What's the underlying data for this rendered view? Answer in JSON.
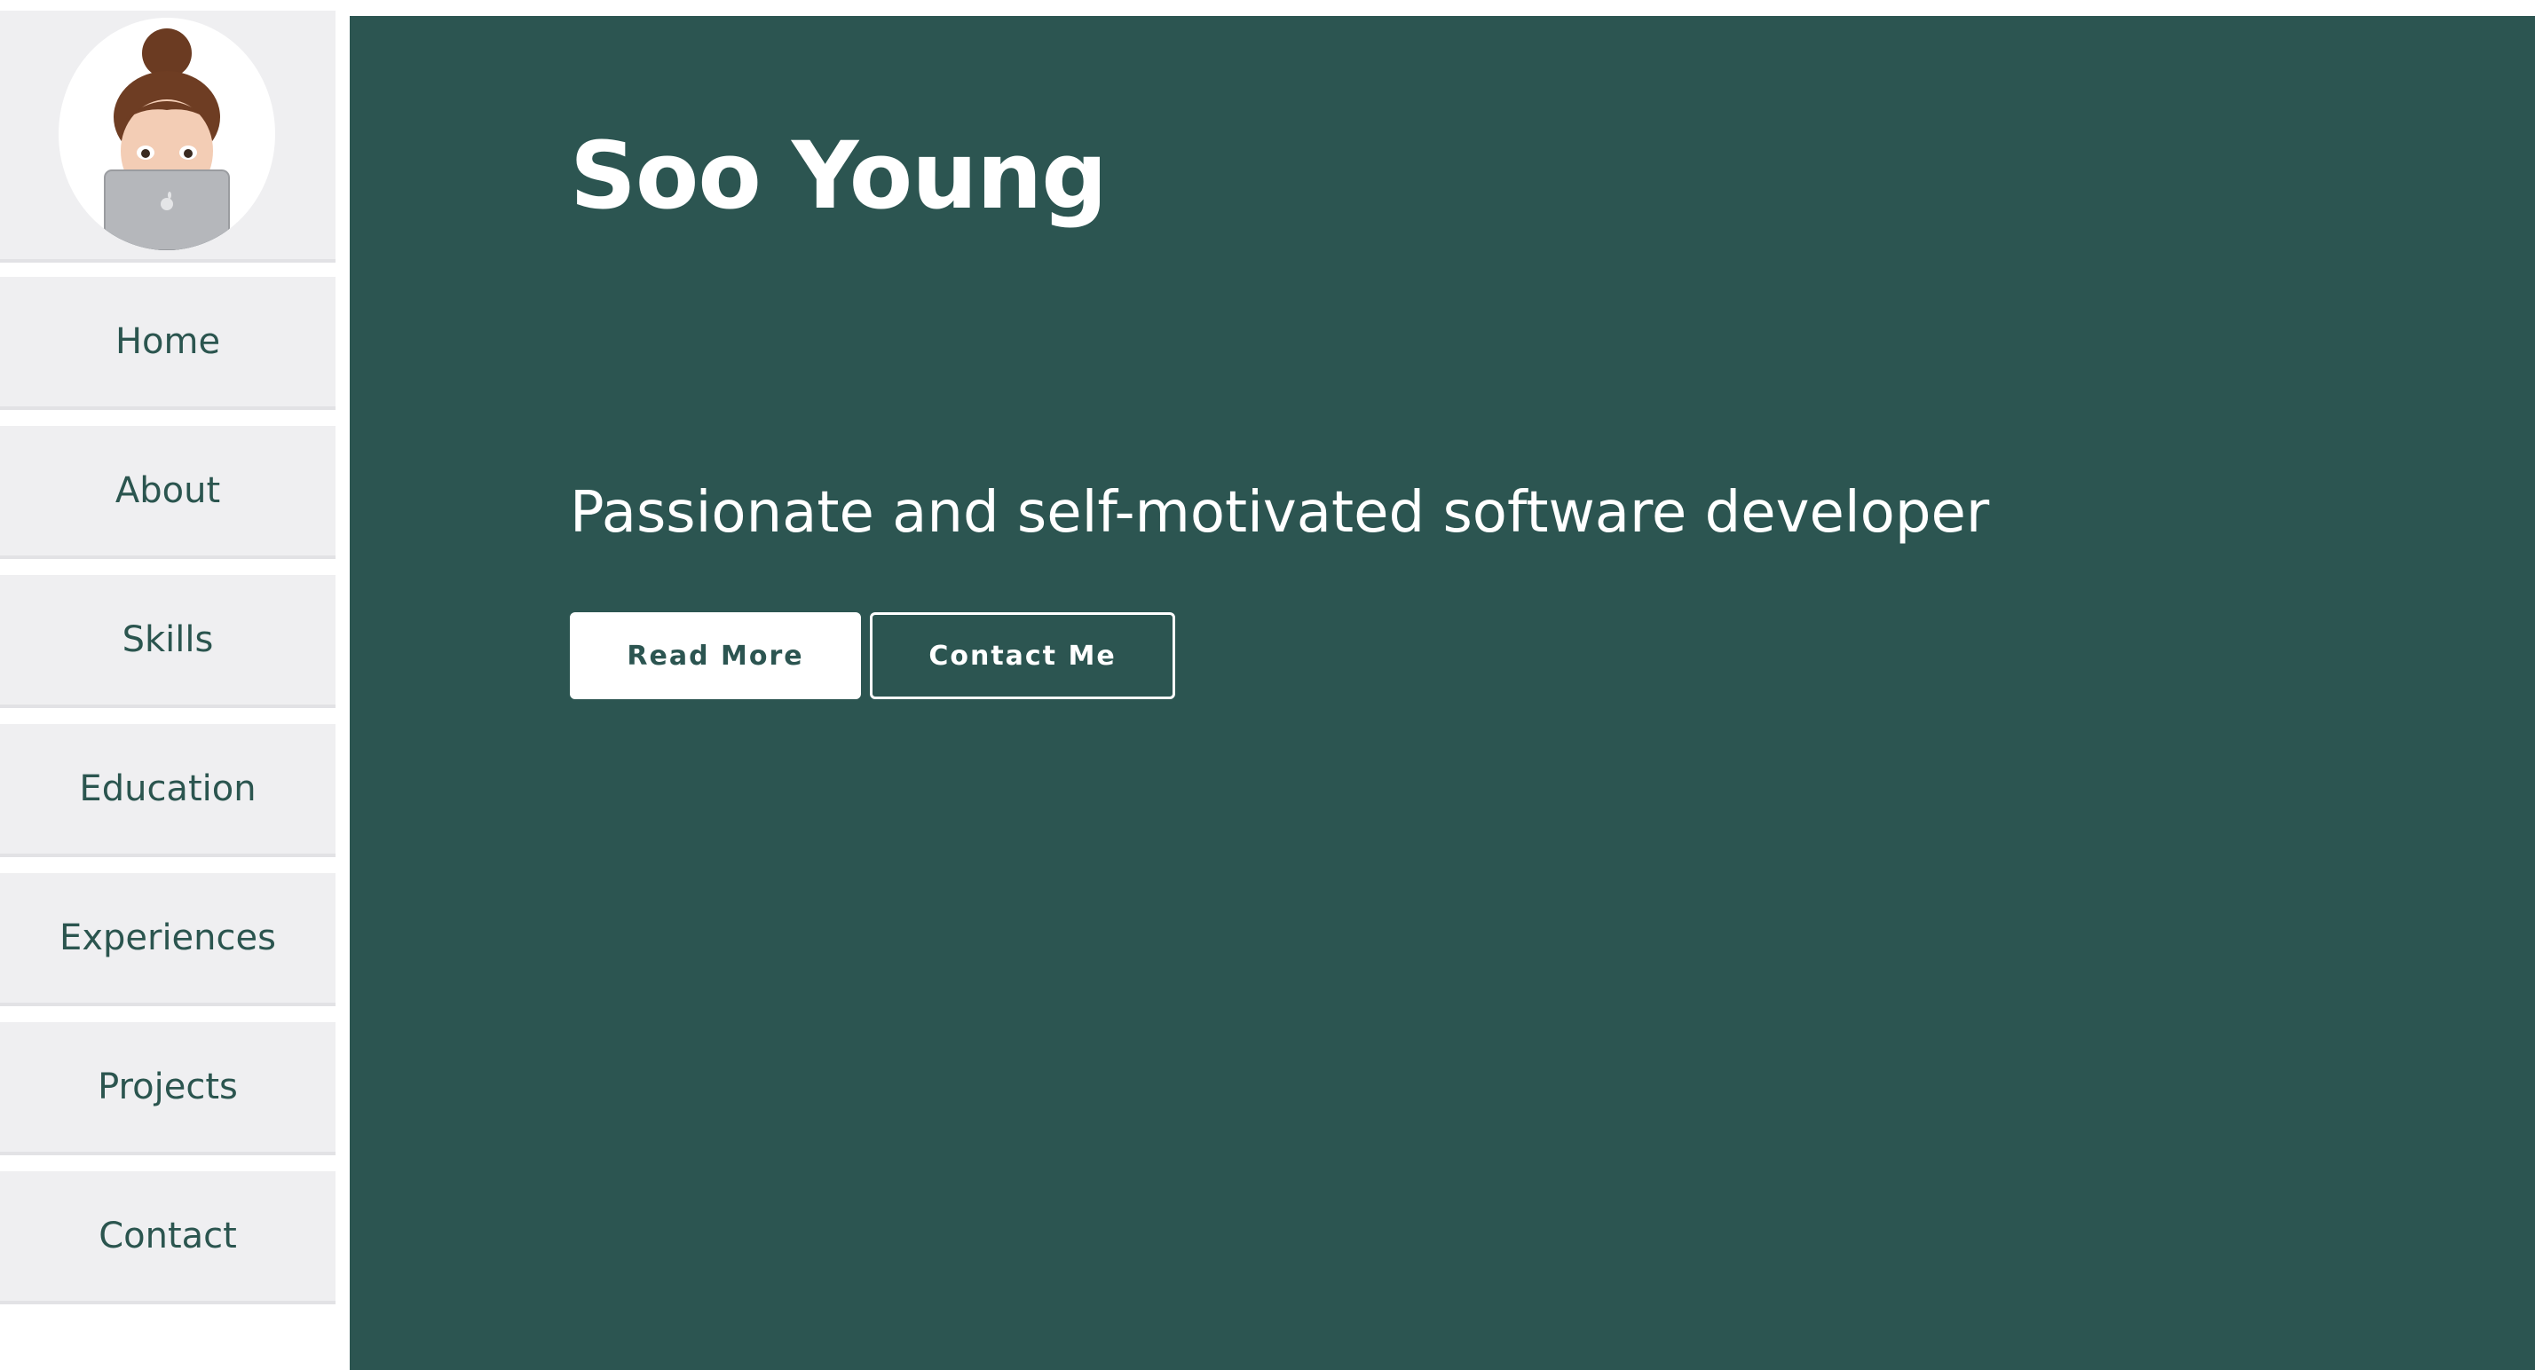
{
  "sidebar": {
    "items": [
      {
        "label": "Home"
      },
      {
        "label": "About"
      },
      {
        "label": "Skills"
      },
      {
        "label": "Education"
      },
      {
        "label": "Experiences"
      },
      {
        "label": "Projects"
      },
      {
        "label": "Contact"
      }
    ]
  },
  "hero": {
    "name": "Soo Young",
    "tagline": "Passionate and self-motivated software developer",
    "read_more_label": "Read More",
    "contact_label": "Contact Me"
  },
  "colors": {
    "main_background": "#2c5551",
    "sidebar_background": "#efeff1",
    "sidebar_text": "#2b554f",
    "button_text_primary": "#2c5551",
    "hero_text": "#ffffff"
  },
  "icons": {
    "avatar": "memoji-with-laptop"
  }
}
